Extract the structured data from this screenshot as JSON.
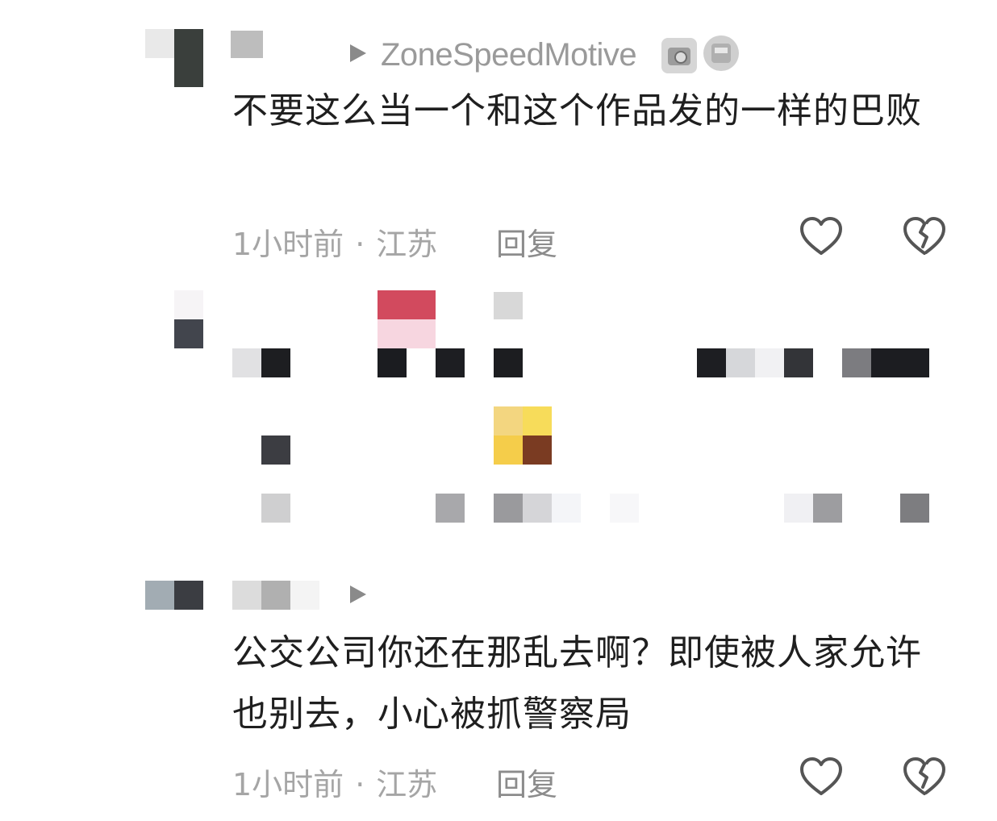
{
  "comments": [
    {
      "reply_to": "ZoneSpeedMotive",
      "badges": [
        "camera-icon",
        "train-icon"
      ],
      "text": "不要这么当一个和这个作品发的一样的巴败",
      "time": "1小时前",
      "location": "江苏",
      "reply_label": "回复",
      "like_icon": "heart-outline-icon",
      "dislike_icon": "broken-heart-icon"
    },
    {
      "censored": true
    },
    {
      "reply_to": "",
      "text": "公交公司你还在那乱去啊？即使被人家允许也别去，小心被抓警察局",
      "time": "1小时前",
      "location": "江苏",
      "reply_label": "回复",
      "like_icon": "heart-outline-icon",
      "dislike_icon": "broken-heart-icon"
    }
  ],
  "colors": {
    "text": "#1f1f1f",
    "meta": "#a5a5a5",
    "reply": "#8c8c8c",
    "icon": "#555555",
    "censor_red": "#d24a5e",
    "censor_yellow": "#f5cd4a"
  }
}
